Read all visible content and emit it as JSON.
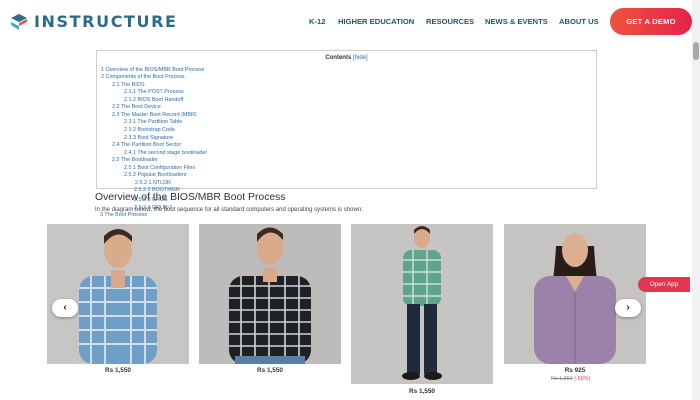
{
  "header": {
    "logo_text": "INSTRUCTURE",
    "nav": [
      "K-12",
      "HIGHER EDUCATION",
      "RESOURCES",
      "NEWS & EVENTS",
      "ABOUT US"
    ],
    "cta_label": "GET A DEMO"
  },
  "toc": {
    "title": "Contents",
    "toggle": "[hide]",
    "items": [
      "1 Overview of the BIOS/MBR Boot Process",
      "2 Components of the Boot Process",
      "2.1 The BIOS",
      "2.1.1 The POST Process",
      "2.1.2 BIOS Boot Handoff",
      "2.2 The Boot Device",
      "2.3 The Master Boot Record (MBR)",
      "2.3.1 The Partition Table",
      "2.3.2 Bootstrap Code",
      "2.3.3 Boot Signature",
      "2.4 The Partition Boot Sector",
      "2.4.1 The second stage bootloader",
      "2.5 The Bootloader",
      "2.5.1 Boot Configuration Files",
      "2.5.2 Popular Bootloaders",
      "2.5.2.1 NTLDR",
      "2.5.2.2 BOOTMGR",
      "2.5.2.3 GRUB",
      "2.5.2.4 GRUB 2",
      "3 The Boot Process"
    ]
  },
  "article": {
    "heading": "Overview of the BIOS/MBR Boot Process",
    "text": "In the diagram below, the boot sequence for all standard computers and operating systems is shown:"
  },
  "products": [
    {
      "price": "Rs 1,550"
    },
    {
      "price": "Rs 1,550"
    },
    {
      "price": "Rs 1,550"
    },
    {
      "price": "Rs 925",
      "old_price": "Rs 1,850",
      "discount": "(-50%)"
    }
  ],
  "carousel": {
    "prev": "‹",
    "next": "›"
  },
  "open_app_label": "Open App",
  "colors": {
    "brand": "#2c6b89",
    "nav": "#1c5675",
    "cta": "#e4234c",
    "link": "#2a6ea6",
    "discount": "#e23b5b"
  }
}
